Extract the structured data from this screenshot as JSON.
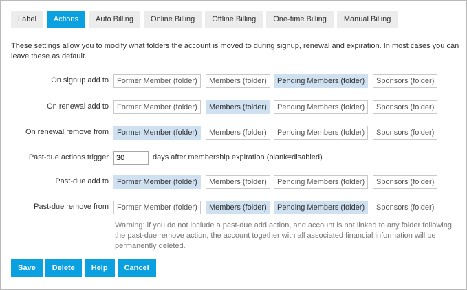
{
  "tabs": [
    "Label",
    "Actions",
    "Auto Billing",
    "Online Billing",
    "Offline Billing",
    "One-time Billing",
    "Manual Billing"
  ],
  "active_tab": "Actions",
  "intro": "These settings allow you to modify what folders the account is moved to during signup, renewal and expiration. In most cases you can leave these as default.",
  "folders": [
    "Former Member (folder)",
    "Members (folder)",
    "Pending Members (folder)",
    "Sponsors (folder)"
  ],
  "rows": {
    "signup_add": {
      "label": "On signup add to",
      "selected": [
        false,
        false,
        true,
        false
      ]
    },
    "renewal_add": {
      "label": "On renewal add to",
      "selected": [
        false,
        true,
        false,
        false
      ]
    },
    "renewal_remove": {
      "label": "On renewal remove from",
      "selected": [
        true,
        false,
        false,
        false
      ]
    },
    "pastdue_add": {
      "label": "Past-due add to",
      "selected": [
        true,
        false,
        false,
        false
      ]
    },
    "pastdue_remove": {
      "label": "Past-due remove from",
      "selected": [
        false,
        true,
        true,
        false
      ]
    }
  },
  "pastdue_trigger": {
    "label": "Past-due actions trigger",
    "value": "30",
    "suffix": "days after membership expiration (blank=disabled)"
  },
  "warning": "Warning: if you do not include a past-due add action, and account is not linked to any folder following the past-due remove action, the account together with all associated financial information will be permanently deleted.",
  "buttons": {
    "save": "Save",
    "delete": "Delete",
    "help": "Help",
    "cancel": "Cancel"
  },
  "colors": {
    "accent": "#0ba0e0",
    "selected_chip": "#cfe0f1",
    "tab_bg": "#ececec"
  }
}
